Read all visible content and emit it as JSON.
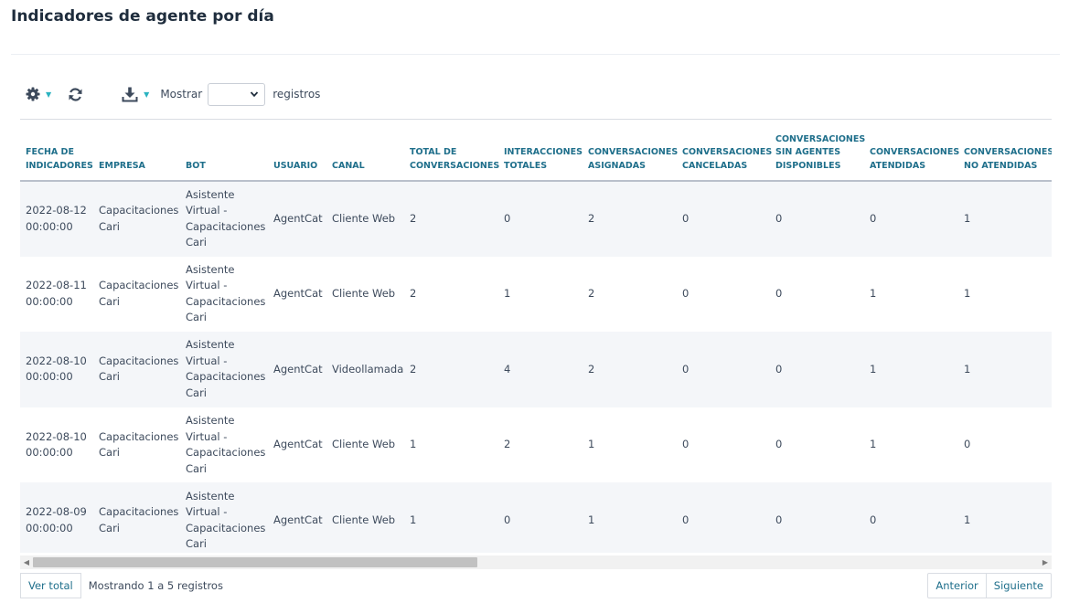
{
  "page": {
    "title": "Indicadores de agente por día"
  },
  "toolbar": {
    "settings_icon": "gear-icon",
    "refresh_icon": "refresh-icon",
    "download_icon": "download-icon",
    "show_label": "Mostrar",
    "records_label": "registros",
    "select_value": "",
    "accent_color": "#2bb3c0"
  },
  "table": {
    "columns": [
      "Fecha de indicadores",
      "Empresa",
      "Bot",
      "Usuario",
      "Canal",
      "Total de conversaciones",
      "Interacciones totales",
      "Conversaciones asignadas",
      "Conversaciones canceladas",
      "Conversaciones sin agentes disponibles",
      "Conversaciones atendidas",
      "Conversaciones no atendidas"
    ],
    "rows": [
      [
        "2022-08-12 00:00:00",
        "Capacitaciones Cari",
        "Asistente Virtual - Capacitaciones Cari",
        "AgentCat",
        "Cliente Web",
        "2",
        "0",
        "2",
        "0",
        "0",
        "0",
        "1"
      ],
      [
        "2022-08-11 00:00:00",
        "Capacitaciones Cari",
        "Asistente Virtual - Capacitaciones Cari",
        "AgentCat",
        "Cliente Web",
        "2",
        "1",
        "2",
        "0",
        "0",
        "1",
        "1"
      ],
      [
        "2022-08-10 00:00:00",
        "Capacitaciones Cari",
        "Asistente Virtual - Capacitaciones Cari",
        "AgentCat",
        "Videollamada",
        "2",
        "4",
        "2",
        "0",
        "0",
        "1",
        "1"
      ],
      [
        "2022-08-10 00:00:00",
        "Capacitaciones Cari",
        "Asistente Virtual - Capacitaciones Cari",
        "AgentCat",
        "Cliente Web",
        "1",
        "2",
        "1",
        "0",
        "0",
        "1",
        "0"
      ],
      [
        "2022-08-09 00:00:00",
        "Capacitaciones Cari",
        "Asistente Virtual - Capacitaciones Cari",
        "AgentCat",
        "Cliente Web",
        "1",
        "0",
        "1",
        "0",
        "0",
        "0",
        "1"
      ]
    ]
  },
  "footer": {
    "view_all_label": "Ver total",
    "info_text": "Mostrando 1 a 5 registros",
    "prev_label": "Anterior",
    "next_label": "Siguiente"
  }
}
